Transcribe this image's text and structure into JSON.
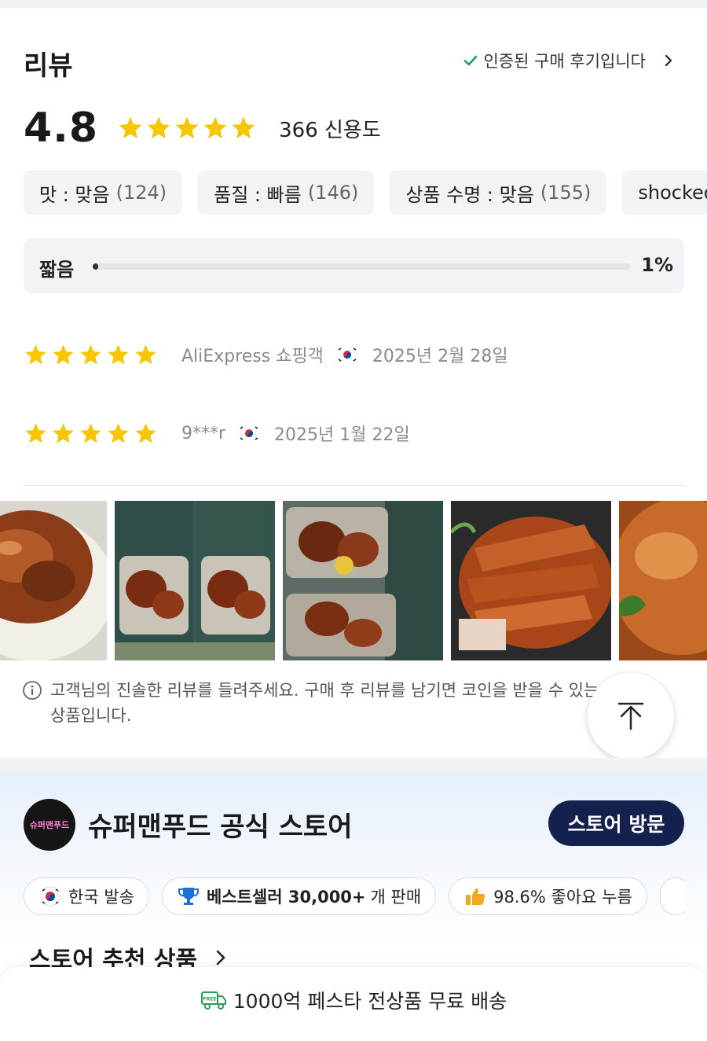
{
  "review": {
    "title": "리뷰",
    "verified_text": "인증된 구매 후기입니다",
    "rating": "4.8",
    "rating_count": "366 신용도",
    "star_color": "#f7c600",
    "chips": [
      {
        "label": "맛 : 맞음",
        "count": "(124)"
      },
      {
        "label": "품질 : 빠름",
        "count": "(146)"
      },
      {
        "label": "상품 수명 : 맞음",
        "count": "(155)"
      },
      {
        "label": "shocked",
        "count": ""
      }
    ],
    "bar": {
      "label": "짧음",
      "percent": "1%",
      "fraction": 0.01
    },
    "items": [
      {
        "reviewer": "AliExpress 쇼핑객",
        "date": "2025년 2월 28일",
        "stars": 5
      },
      {
        "reviewer": "9***r",
        "date": "2025년 1월 22일",
        "stars": 5
      }
    ],
    "photos": [
      "roast-duck-photo-1",
      "smoked-boneless-duck-packs-photo",
      "duck-packages-photo",
      "sliced-roast-duck-photo",
      "roast-duck-photo-2"
    ],
    "notice_text": "고객님의 진솔한 리뷰를 들려주세요. 구매 후 리뷰를 남기면 코인을 받을 수 있는\n상품입니다."
  },
  "store": {
    "logo_text": "슈퍼맨푸드",
    "name": "슈퍼맨푸드 공식 스토어",
    "visit_label": "스토어 방문",
    "chips": [
      {
        "icon": "korea-flag-icon",
        "bold": "",
        "text": "한국 발송"
      },
      {
        "icon": "trophy-icon",
        "bold": "베스트셀러 30,000+",
        "text": "개 판매"
      },
      {
        "icon": "thumbs-up-icon",
        "bold": "",
        "text": "98.6% 좋아요 누름"
      }
    ],
    "recommended_title": "스토어 추천 상품"
  },
  "shipping": {
    "text": "1000억 페스타 전상품 무료 배송",
    "icon_label": "FREE"
  },
  "colors": {
    "check_green": "#1aa260",
    "visit_button": "#14214f",
    "trophy_blue": "#1f6fd6",
    "thumb_orange": "#f5a623",
    "shipping_green": "#2e9e5b"
  }
}
